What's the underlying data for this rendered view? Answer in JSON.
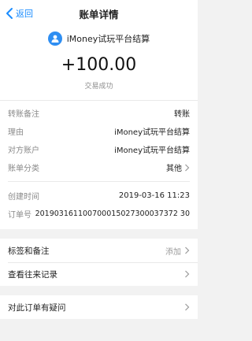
{
  "nav": {
    "back_label": "返回",
    "title": "账单详情"
  },
  "header": {
    "merchant_name": "iMoney试玩平台结算",
    "amount": "+100.00",
    "status": "交易成功"
  },
  "details": {
    "group1": [
      {
        "label": "转账备注",
        "value": "转账"
      },
      {
        "label": "理由",
        "value": "iMoney试玩平台结算"
      },
      {
        "label": "对方账户",
        "value": "iMoney试玩平台结算"
      },
      {
        "label": "账单分类",
        "value": "其他"
      }
    ],
    "group2": [
      {
        "label": "创建时间",
        "value": "2019-03-16 11:23"
      },
      {
        "label": "订单号",
        "value": "201903161100700015027300037372 30"
      }
    ]
  },
  "actions": {
    "tags_label": "标签和备注",
    "tags_action": "添加",
    "history_label": "查看往来记录",
    "question_label": "对此订单有疑问"
  },
  "colors": {
    "accent": "#1a8cff",
    "avatar_bg": "#2e8ef2",
    "background": "#f2f2f2"
  },
  "icons": {
    "back": "chevron-left-icon",
    "avatar": "user-icon",
    "row_chevron": "chevron-right-icon"
  }
}
